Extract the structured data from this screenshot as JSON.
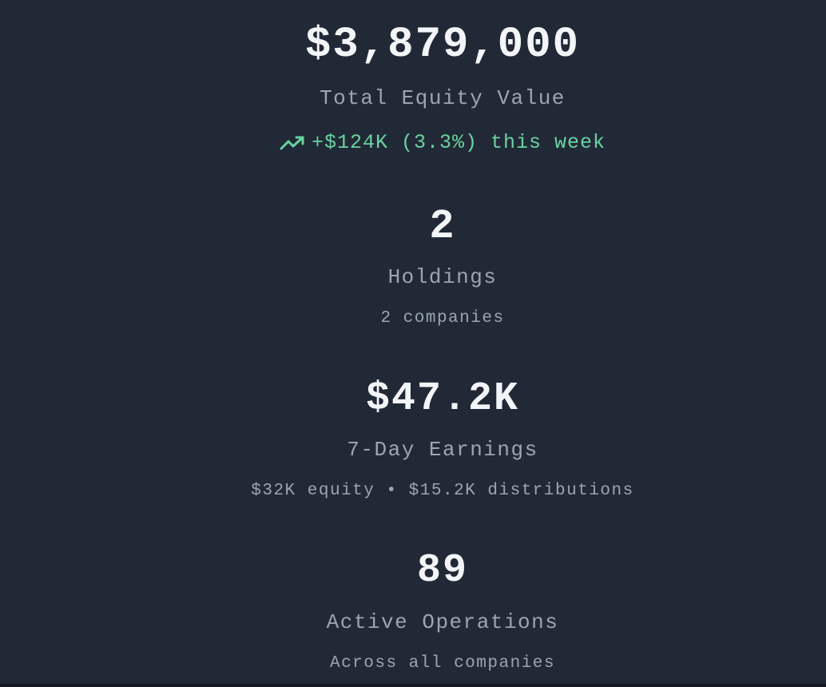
{
  "total_equity": {
    "value": "$3,879,000",
    "label": "Total Equity Value",
    "trend": "+$124K (3.3%) this week",
    "trend_icon": "trending-up-icon",
    "trend_color": "#69d3a0"
  },
  "holdings": {
    "value": "2",
    "label": "Holdings",
    "sub": "2 companies"
  },
  "earnings": {
    "value": "$47.2K",
    "label": "7-Day Earnings",
    "sub": "$32K equity • $15.2K distributions"
  },
  "operations": {
    "value": "89",
    "label": "Active Operations",
    "sub": "Across all companies"
  }
}
